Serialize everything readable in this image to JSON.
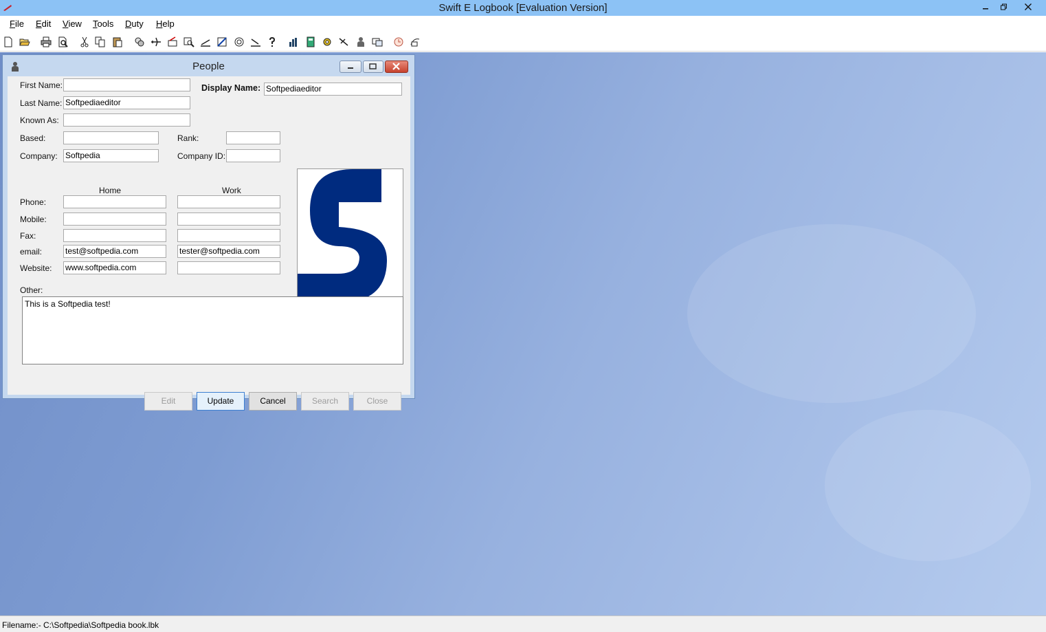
{
  "window": {
    "title": "Swift E Logbook [Evaluation Version]"
  },
  "menu": [
    {
      "label": "File",
      "u": "F",
      "rest": "ile"
    },
    {
      "label": "Edit",
      "u": "E",
      "rest": "dit"
    },
    {
      "label": "View",
      "u": "V",
      "rest": "iew"
    },
    {
      "label": "Tools",
      "u": "T",
      "rest": "ools"
    },
    {
      "label": "Duty",
      "u": "D",
      "rest": "uty"
    },
    {
      "label": "Help",
      "u": "H",
      "rest": "elp"
    }
  ],
  "toolbar_icons": [
    "new-icon",
    "open-icon",
    "print-icon",
    "print-preview-icon",
    "cut-icon",
    "copy-icon",
    "paste-icon",
    "search-records-icon",
    "aircraft-icon",
    "flight-icon",
    "find-icon",
    "takeoff-icon",
    "map-icon",
    "airport-icon",
    "landing-icon",
    "help-icon",
    "chart-icon",
    "calculator-icon",
    "settings-icon",
    "plane-icon",
    "people-icon",
    "tools-icon",
    "clock-icon",
    "export-icon"
  ],
  "dialog": {
    "title": "People",
    "labels": {
      "first_name": "First Name:",
      "last_name": "Last Name:",
      "known_as": "Known As:",
      "based": "Based:",
      "company": "Company:",
      "rank": "Rank:",
      "company_id": "Company ID:",
      "display_name": "Display Name:",
      "home": "Home",
      "work": "Work",
      "phone": "Phone:",
      "mobile": "Mobile:",
      "fax": "Fax:",
      "email": "email:",
      "website": "Website:",
      "other": "Other:"
    },
    "values": {
      "first_name": "",
      "last_name": "Softpediaeditor",
      "known_as": "",
      "based": "",
      "company": "Softpedia",
      "rank": "",
      "company_id": "",
      "display_name": "Softpediaeditor",
      "home_phone": "",
      "work_phone": "",
      "home_mobile": "",
      "work_mobile": "",
      "home_fax": "",
      "work_fax": "",
      "home_email": "test@softpedia.com",
      "work_email": "tester@softpedia.com",
      "home_website": "www.softpedia.com",
      "work_website": "",
      "other": "This is a Softpedia test!"
    },
    "buttons": {
      "edit": "Edit",
      "update": "Update",
      "cancel": "Cancel",
      "search": "Search",
      "close": "Close"
    }
  },
  "status": {
    "filename": "Filename:- C:\\Softpedia\\Softpedia book.lbk"
  },
  "colors": {
    "titlebar": "#8cc2f5",
    "logo_blue": "#002b7f",
    "desktop": "#7e9cd2"
  }
}
